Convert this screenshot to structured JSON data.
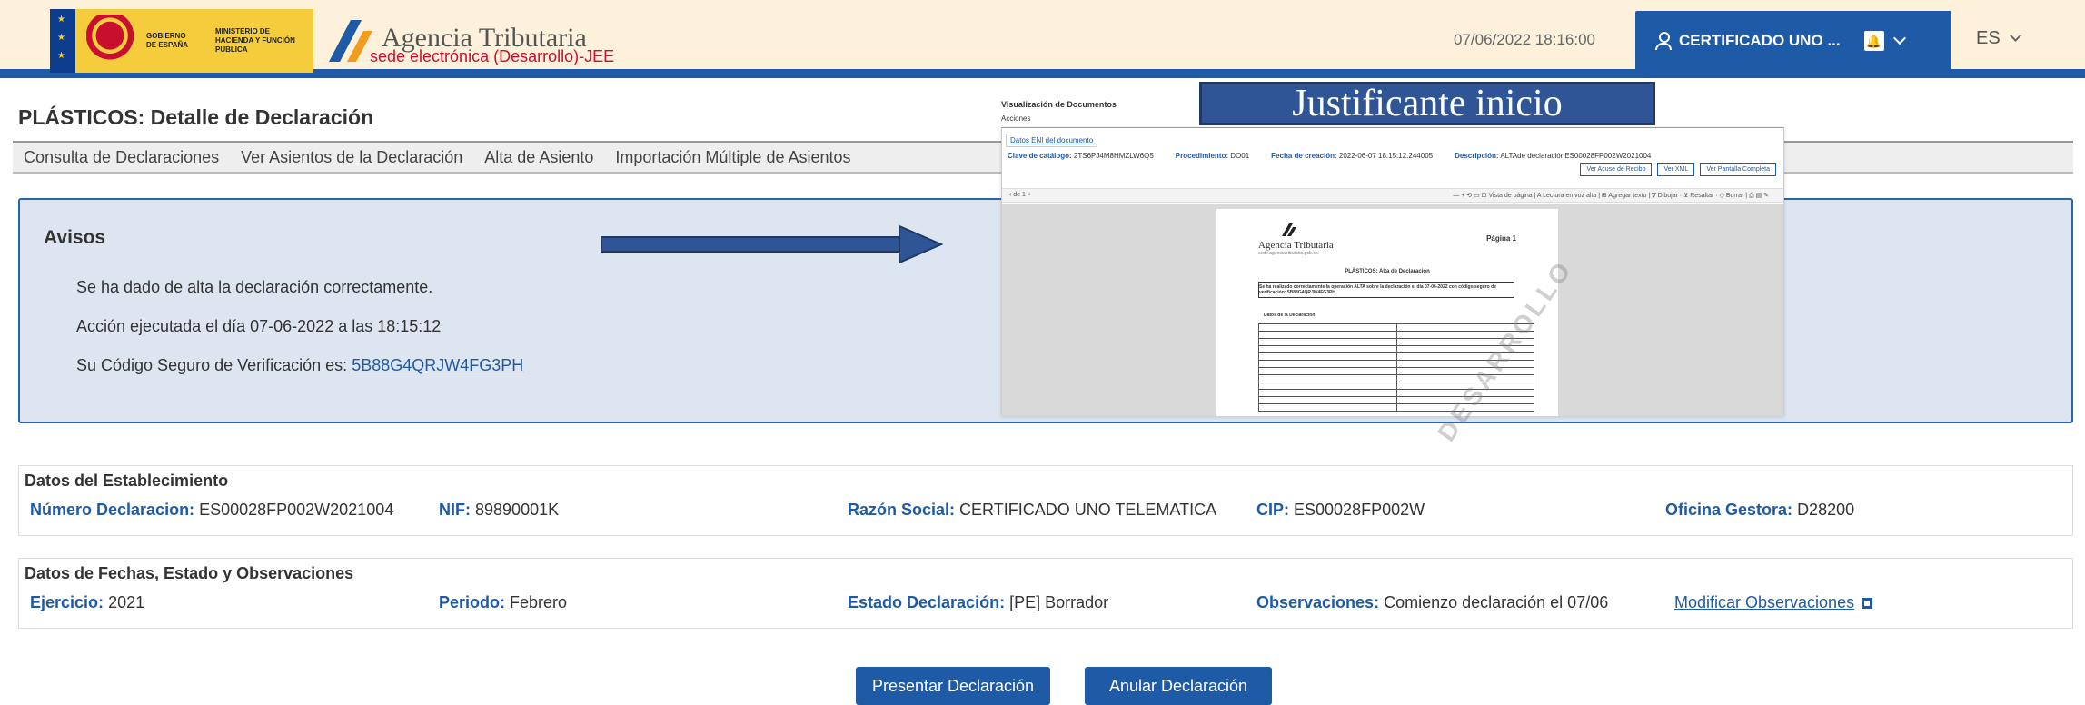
{
  "header": {
    "gov_text_1": "GOBIERNO DE ESPAÑA",
    "gov_text_2": "MINISTERIO DE HACIENDA Y FUNCIÓN PÚBLICA",
    "agency_name": "Agencia Tributaria",
    "agency_sub": "sede electrónica (Desarrollo)-JEE",
    "datetime": "07/06/2022 18:16:00",
    "user_label": "CERTIFICADO UNO ...",
    "language": "ES",
    "brand_color": "#1f5aa6",
    "header_bg": "#fdf1dc"
  },
  "page": {
    "title": "PLÁSTICOS: Detalle de Declaración"
  },
  "nav": {
    "items": [
      "Consulta de Declaraciones",
      "Ver Asientos de la Declaración",
      "Alta de Asiento",
      "Importación Múltiple de Asientos"
    ]
  },
  "avisos": {
    "title": "Avisos",
    "line1": "Se ha dado de alta la declaración correctamente.",
    "line2": "Acción ejecutada el día 07-06-2022 a las 18:15:12",
    "line3_prefix": "Su Código Seguro de Verificación es: ",
    "csv_code": "5B88G4QRJW4FG3PH"
  },
  "overlay": {
    "banner": "Justificante inicio",
    "doc_title": "Visualización de Documentos",
    "doc_actions": "Acciones",
    "tab": "Datos ENI del documento",
    "meta": {
      "catalog_label": "Clave de catálogo:",
      "catalog_value": "2TS6PJ4M8HMZLW6Q5",
      "proc_label": "Procedimiento:",
      "proc_value": "DO01",
      "date_label": "Fecha de creación:",
      "date_value": "2022-06-07 18:15:12.244005",
      "desc_label": "Descripción:",
      "desc_value": "ALTAde declaraciónES00028FP002W2021004"
    },
    "buttons": [
      "Ver Acuse de Recibo",
      "Ver XML",
      "Ver Pantalla Completa"
    ],
    "toolbar_left": "‹  de 1  ⌕",
    "toolbar_right": "—  +  ⟲  ▭   ⊡ Vista de página  |  A Lectura en voz alta  |  ⊞ Agregar texto  |  ∇ Dibujar  ·  ⊻ Resaltar  ·  ◇ Borrar  |  ⎙  ▤  ✎",
    "page": {
      "agency": "Agencia Tributaria",
      "agency_url": "sede.agenciatributaria.gob.es",
      "page_num": "Página 1",
      "heading": "PLÁSTICOS: Alta de Declaración",
      "box_text": "Se ha realizado correctamente la operación ALTA sobre la declaración el día 07-06-2022 con código seguro de verificación: 5B88G4QRJW4FG3PH",
      "section": "Datos de la Declaración",
      "watermark": "DESARROLLO"
    }
  },
  "establecimiento": {
    "title": "Datos del Establecimiento",
    "num_decl_label": "Número Declaracion:",
    "num_decl_value": "ES00028FP002W2021004",
    "nif_label": "NIF:",
    "nif_value": "89890001K",
    "razon_label": "Razón Social:",
    "razon_value": "CERTIFICADO UNO TELEMATICA",
    "cip_label": "CIP:",
    "cip_value": "ES00028FP002W",
    "oficina_label": "Oficina Gestora:",
    "oficina_value": "D28200"
  },
  "fechas": {
    "title": "Datos de Fechas, Estado y Observaciones",
    "ejercicio_label": "Ejercicio:",
    "ejercicio_value": "2021",
    "periodo_label": "Periodo:",
    "periodo_value": "Febrero",
    "estado_label": "Estado Declaración:",
    "estado_value": "[PE] Borrador",
    "obs_label": "Observaciones:",
    "obs_value": "Comienzo declaración el 07/06",
    "modificar_link": "Modificar Observaciones"
  },
  "actions": {
    "presentar": "Presentar Declaración",
    "anular": "Anular Declaración"
  }
}
